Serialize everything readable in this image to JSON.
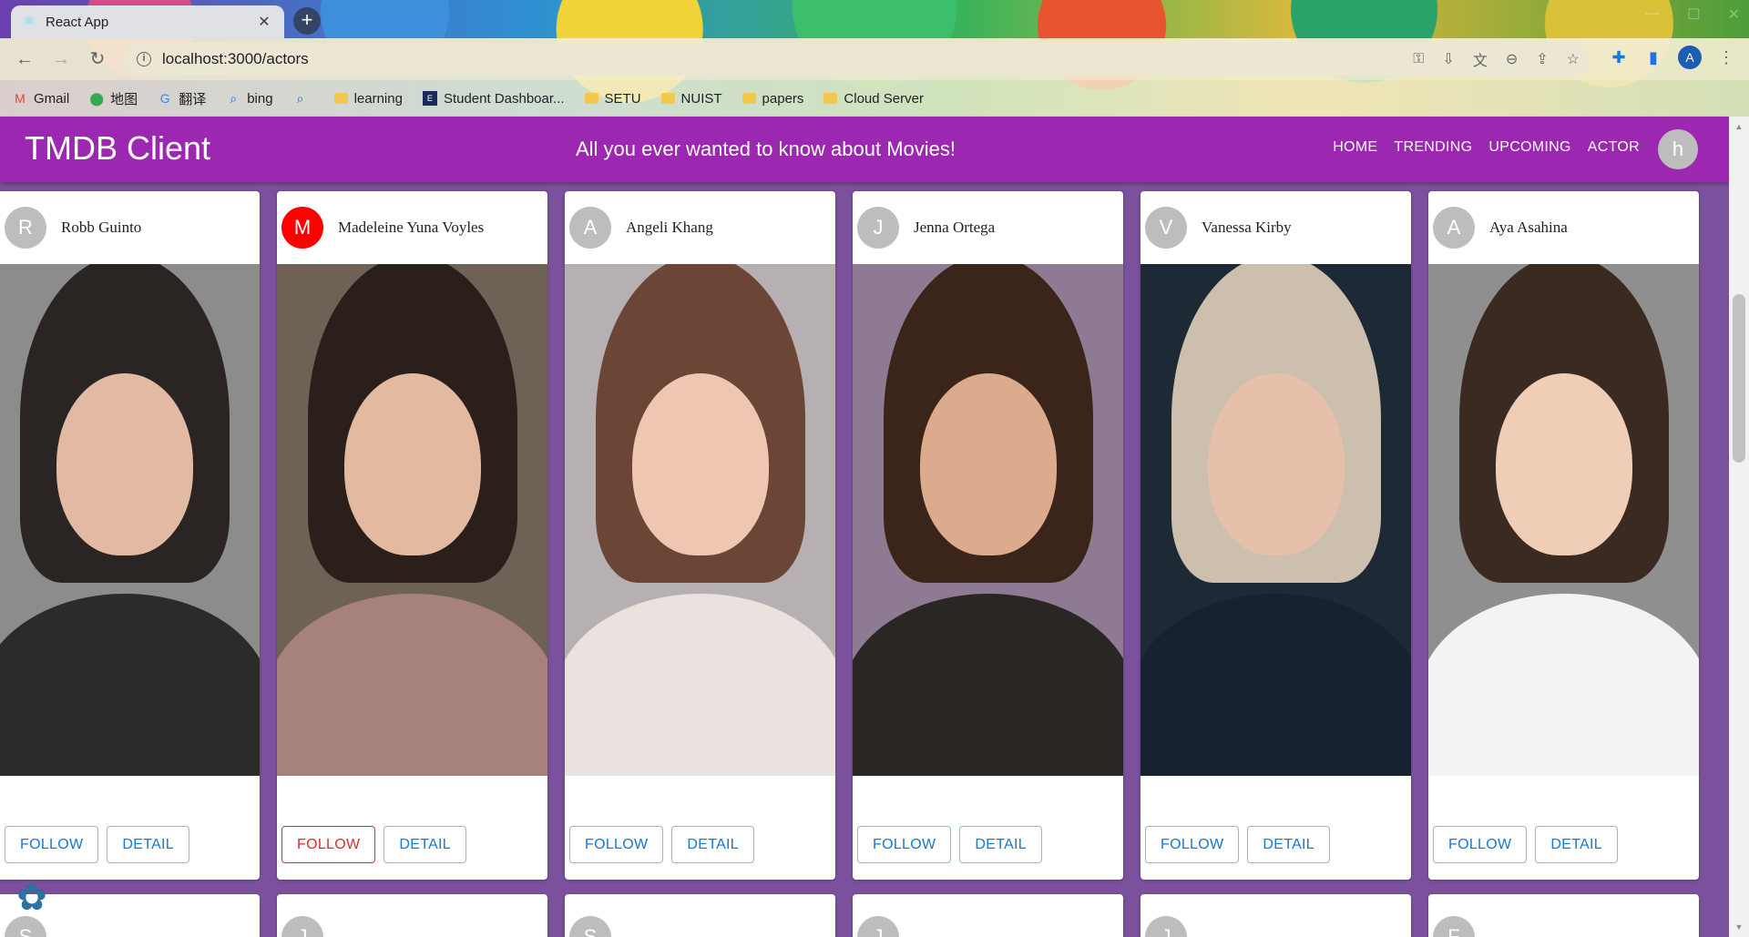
{
  "browser": {
    "tab_title": "React App",
    "url": "localhost:3000/actors",
    "bookmarks": [
      "Gmail",
      "地图",
      "翻译",
      "bing",
      "",
      "learning",
      "Student Dashboar...",
      "SETU",
      "NUIST",
      "papers",
      "Cloud Server"
    ],
    "profile_initial": "A"
  },
  "app": {
    "brand": "TMDB Client",
    "tagline": "All you ever wanted to know about Movies!",
    "nav": [
      "HOME",
      "TRENDING",
      "UPCOMING",
      "ACTOR"
    ],
    "user_initial": "h"
  },
  "actors": [
    {
      "initial": "R",
      "name": "Robb Guinto",
      "follow": "FOLLOW",
      "detail": "DETAIL",
      "following": false,
      "bg": "#8c8c8c",
      "skin": "#e2b9a3",
      "hair": "#2a2422",
      "cloth": "#2b2b2b"
    },
    {
      "initial": "M",
      "name": "Madeleine Yuna Voyles",
      "follow": "FOLLOW",
      "detail": "DETAIL",
      "following": true,
      "bg": "#6e6257",
      "skin": "#e3b9a0",
      "hair": "#2b1f1b",
      "cloth": "#a7817b"
    },
    {
      "initial": "A",
      "name": "Angeli Khang",
      "follow": "FOLLOW",
      "detail": "DETAIL",
      "following": false,
      "bg": "#b7b0b3",
      "skin": "#efc6b2",
      "hair": "#6b4536",
      "cloth": "#e9e2df"
    },
    {
      "initial": "J",
      "name": "Jenna Ortega",
      "follow": "FOLLOW",
      "detail": "DETAIL",
      "following": false,
      "bg": "#8e7b93",
      "skin": "#dcaa8c",
      "hair": "#3b2419",
      "cloth": "#2a2624"
    },
    {
      "initial": "V",
      "name": "Vanessa Kirby",
      "follow": "FOLLOW",
      "detail": "DETAIL",
      "following": false,
      "bg": "#1d2a36",
      "skin": "#e7c0ac",
      "hair": "#cdbfae",
      "cloth": "#172230"
    },
    {
      "initial": "A",
      "name": "Aya Asahina",
      "follow": "FOLLOW",
      "detail": "DETAIL",
      "following": false,
      "bg": "#8f8f8f",
      "skin": "#f0cdb6",
      "hair": "#3a2a22",
      "cloth": "#f3f3f3"
    }
  ],
  "next_row_initials": [
    "S",
    "J",
    "S",
    "J",
    "J",
    "F"
  ]
}
